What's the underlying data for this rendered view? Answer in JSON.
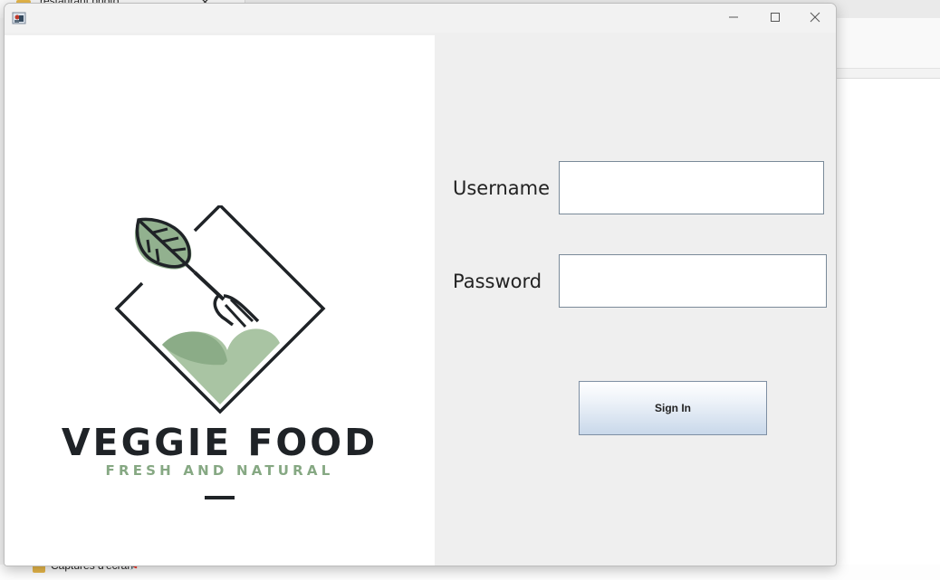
{
  "background": {
    "explorer_tab_title": "restaurant photo",
    "sidebar_folder_label": "Captures d'écran"
  },
  "window": {
    "controls": {
      "minimize": "minimize-icon",
      "maximize": "maximize-icon",
      "close": "close-icon"
    }
  },
  "logo": {
    "brand_name": "VEGGIE FOOD",
    "tagline": "FRESH AND NATURAL",
    "colors": {
      "dark": "#1f2327",
      "green": "#86a883",
      "light_green": "#a9c4a3"
    }
  },
  "form": {
    "username_label": "Username",
    "username_value": "",
    "password_label": "Password",
    "password_value": "",
    "signin_label": "Sign In"
  }
}
